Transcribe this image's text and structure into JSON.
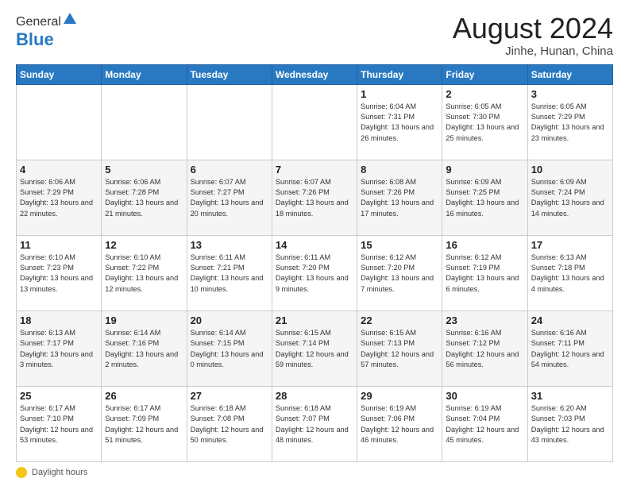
{
  "header": {
    "logo_general": "General",
    "logo_blue": "Blue",
    "title": "August 2024",
    "location": "Jinhe, Hunan, China"
  },
  "footer": {
    "label": "Daylight hours"
  },
  "days_of_week": [
    "Sunday",
    "Monday",
    "Tuesday",
    "Wednesday",
    "Thursday",
    "Friday",
    "Saturday"
  ],
  "weeks": [
    [
      {
        "day": "",
        "info": ""
      },
      {
        "day": "",
        "info": ""
      },
      {
        "day": "",
        "info": ""
      },
      {
        "day": "",
        "info": ""
      },
      {
        "day": "1",
        "info": "Sunrise: 6:04 AM\nSunset: 7:31 PM\nDaylight: 13 hours and 26 minutes."
      },
      {
        "day": "2",
        "info": "Sunrise: 6:05 AM\nSunset: 7:30 PM\nDaylight: 13 hours and 25 minutes."
      },
      {
        "day": "3",
        "info": "Sunrise: 6:05 AM\nSunset: 7:29 PM\nDaylight: 13 hours and 23 minutes."
      }
    ],
    [
      {
        "day": "4",
        "info": "Sunrise: 6:06 AM\nSunset: 7:29 PM\nDaylight: 13 hours and 22 minutes."
      },
      {
        "day": "5",
        "info": "Sunrise: 6:06 AM\nSunset: 7:28 PM\nDaylight: 13 hours and 21 minutes."
      },
      {
        "day": "6",
        "info": "Sunrise: 6:07 AM\nSunset: 7:27 PM\nDaylight: 13 hours and 20 minutes."
      },
      {
        "day": "7",
        "info": "Sunrise: 6:07 AM\nSunset: 7:26 PM\nDaylight: 13 hours and 18 minutes."
      },
      {
        "day": "8",
        "info": "Sunrise: 6:08 AM\nSunset: 7:26 PM\nDaylight: 13 hours and 17 minutes."
      },
      {
        "day": "9",
        "info": "Sunrise: 6:09 AM\nSunset: 7:25 PM\nDaylight: 13 hours and 16 minutes."
      },
      {
        "day": "10",
        "info": "Sunrise: 6:09 AM\nSunset: 7:24 PM\nDaylight: 13 hours and 14 minutes."
      }
    ],
    [
      {
        "day": "11",
        "info": "Sunrise: 6:10 AM\nSunset: 7:23 PM\nDaylight: 13 hours and 13 minutes."
      },
      {
        "day": "12",
        "info": "Sunrise: 6:10 AM\nSunset: 7:22 PM\nDaylight: 13 hours and 12 minutes."
      },
      {
        "day": "13",
        "info": "Sunrise: 6:11 AM\nSunset: 7:21 PM\nDaylight: 13 hours and 10 minutes."
      },
      {
        "day": "14",
        "info": "Sunrise: 6:11 AM\nSunset: 7:20 PM\nDaylight: 13 hours and 9 minutes."
      },
      {
        "day": "15",
        "info": "Sunrise: 6:12 AM\nSunset: 7:20 PM\nDaylight: 13 hours and 7 minutes."
      },
      {
        "day": "16",
        "info": "Sunrise: 6:12 AM\nSunset: 7:19 PM\nDaylight: 13 hours and 6 minutes."
      },
      {
        "day": "17",
        "info": "Sunrise: 6:13 AM\nSunset: 7:18 PM\nDaylight: 13 hours and 4 minutes."
      }
    ],
    [
      {
        "day": "18",
        "info": "Sunrise: 6:13 AM\nSunset: 7:17 PM\nDaylight: 13 hours and 3 minutes."
      },
      {
        "day": "19",
        "info": "Sunrise: 6:14 AM\nSunset: 7:16 PM\nDaylight: 13 hours and 2 minutes."
      },
      {
        "day": "20",
        "info": "Sunrise: 6:14 AM\nSunset: 7:15 PM\nDaylight: 13 hours and 0 minutes."
      },
      {
        "day": "21",
        "info": "Sunrise: 6:15 AM\nSunset: 7:14 PM\nDaylight: 12 hours and 59 minutes."
      },
      {
        "day": "22",
        "info": "Sunrise: 6:15 AM\nSunset: 7:13 PM\nDaylight: 12 hours and 57 minutes."
      },
      {
        "day": "23",
        "info": "Sunrise: 6:16 AM\nSunset: 7:12 PM\nDaylight: 12 hours and 56 minutes."
      },
      {
        "day": "24",
        "info": "Sunrise: 6:16 AM\nSunset: 7:11 PM\nDaylight: 12 hours and 54 minutes."
      }
    ],
    [
      {
        "day": "25",
        "info": "Sunrise: 6:17 AM\nSunset: 7:10 PM\nDaylight: 12 hours and 53 minutes."
      },
      {
        "day": "26",
        "info": "Sunrise: 6:17 AM\nSunset: 7:09 PM\nDaylight: 12 hours and 51 minutes."
      },
      {
        "day": "27",
        "info": "Sunrise: 6:18 AM\nSunset: 7:08 PM\nDaylight: 12 hours and 50 minutes."
      },
      {
        "day": "28",
        "info": "Sunrise: 6:18 AM\nSunset: 7:07 PM\nDaylight: 12 hours and 48 minutes."
      },
      {
        "day": "29",
        "info": "Sunrise: 6:19 AM\nSunset: 7:06 PM\nDaylight: 12 hours and 46 minutes."
      },
      {
        "day": "30",
        "info": "Sunrise: 6:19 AM\nSunset: 7:04 PM\nDaylight: 12 hours and 45 minutes."
      },
      {
        "day": "31",
        "info": "Sunrise: 6:20 AM\nSunset: 7:03 PM\nDaylight: 12 hours and 43 minutes."
      }
    ]
  ]
}
